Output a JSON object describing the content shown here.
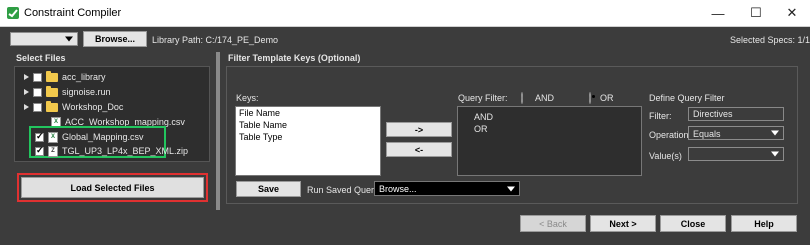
{
  "window": {
    "title": "Constraint Compiler",
    "minimize_icon": "minimize-icon",
    "maximize_icon": "maximize-icon",
    "close_icon": "close-icon"
  },
  "toolbar": {
    "library_select_value": "",
    "browse_label": "Browse...",
    "library_path_label": "Library Path: C:/174_PE_Demo",
    "selected_specs_label": "Selected Specs: 1/1"
  },
  "select_files": {
    "heading": "Select Files",
    "items": [
      {
        "label": "acc_library",
        "type": "folder",
        "expandable": true,
        "checked": false
      },
      {
        "label": "signoise.run",
        "type": "folder",
        "expandable": true,
        "checked": false
      },
      {
        "label": "Workshop_Doc",
        "type": "folder",
        "expandable": true,
        "checked": false
      },
      {
        "label": "ACC_Workshop_mapping.csv",
        "type": "csv",
        "expandable": false,
        "checked": null
      },
      {
        "label": "Global_Mapping.csv",
        "type": "csv",
        "expandable": false,
        "checked": true
      },
      {
        "label": "TGL_UP3_LP4x_BEP_XML.zip",
        "type": "zip",
        "expandable": false,
        "checked": true
      }
    ],
    "load_button_label": "Load Selected Files",
    "highlight_color": "#22c55e",
    "load_highlight_color": "#e03131"
  },
  "filter": {
    "heading": "Filter Template Keys (Optional)",
    "keys_label": "Keys:",
    "keys": [
      "File Name",
      "Table Name",
      "Table Type"
    ],
    "add_button_label": "->",
    "remove_button_label": "<-",
    "query_filter_label": "Query Filter:",
    "and_label": "AND",
    "or_label": "OR",
    "selected_mode": "OR",
    "query_items": [
      "AND",
      "OR"
    ],
    "save_label": "Save",
    "run_saved_label": "Run Saved Query:",
    "run_saved_value": "Browse...",
    "define_heading": "Define Query Filter",
    "filter_label": "Filter:",
    "filter_value": "Directives",
    "operation_label": "Operation",
    "operation_value": "Equals",
    "values_label": "Value(s)",
    "values_value": ""
  },
  "footer": {
    "back_label": "< Back",
    "next_label": "Next >",
    "close_label": "Close",
    "help_label": "Help"
  }
}
